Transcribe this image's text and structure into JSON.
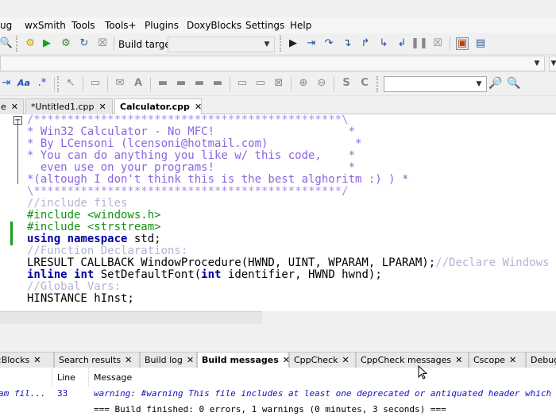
{
  "menu": [
    "ug",
    "wxSmith",
    "Tools",
    "Tools+",
    "Plugins",
    "DoxyBlocks",
    "Settings",
    "Help"
  ],
  "toolbar": {
    "build_target_label": "Build target:",
    "build_target_value": ""
  },
  "tabs": [
    {
      "label": "e",
      "active": false
    },
    {
      "label": "*Untitled1.cpp",
      "active": false
    },
    {
      "label": "Calculator.cpp",
      "active": true
    }
  ],
  "code_lines": [
    {
      "cls": "c-doc-border",
      "text": "/**********************************************\\"
    },
    {
      "cls": "c-doc",
      "text": "* Win32 Calculator - No MFC!                    *"
    },
    {
      "cls": "c-doc",
      "text": "* By LCensoni (lcensoni@hotmail.com)             *"
    },
    {
      "cls": "c-doc",
      "text": "* You can do anything you like w/ this code,    *"
    },
    {
      "cls": "c-doc",
      "text": "  even use on your programs!                    *"
    },
    {
      "cls": "c-doc",
      "text": "*(altough I don't think this is the best alghoritm :) ) *"
    },
    {
      "cls": "c-doc-border",
      "text": "\\**********************************************/"
    },
    {
      "cls": "c-cmt",
      "text": "//include files"
    },
    {
      "cls": "c-pp",
      "text": "#include <windows.h>"
    },
    {
      "cls": "c-pp",
      "text": "#include <strstream>"
    },
    {
      "cls": "mixed-using",
      "text": "using namespace std;"
    },
    {
      "cls": "c-cmt",
      "text": "//Function Declarations:"
    },
    {
      "cls": "mixed-lresult",
      "text": "LRESULT CALLBACK WindowProcedure(HWND, UINT, WPARAM, LPARAM);//Declare Windows procedure"
    },
    {
      "cls": "mixed-inline",
      "text": "inline int SetDefaultFont(int identifier, HWND hwnd);"
    },
    {
      "cls": "c-cmt",
      "text": "//Global Vars:"
    },
    {
      "cls": "c-txt",
      "text": "HINSTANCE hInst;"
    }
  ],
  "code_parts": {
    "using_kw": "using namespace",
    "using_rest": " std;",
    "lresult_code": "LRESULT CALLBACK WindowProcedure(HWND, UINT, WPARAM, LPARAM);",
    "lresult_cmt": "//Declare Windows procedure",
    "inline_kw1": "inline",
    "inline_kw2": "int",
    "inline_mid": " SetDefaultFont(",
    "inline_kw3": "int",
    "inline_rest": " identifier, HWND hwnd);"
  },
  "log_tabs": [
    {
      "label": ":Blocks",
      "active": false
    },
    {
      "label": "Search results",
      "active": false
    },
    {
      "label": "Build log",
      "active": false
    },
    {
      "label": "Build messages",
      "active": true
    },
    {
      "label": "CppCheck",
      "active": false
    },
    {
      "label": "CppCheck messages",
      "active": false
    },
    {
      "label": "Cscope",
      "active": false
    },
    {
      "label": "Debugger",
      "active": false
    }
  ],
  "messages": {
    "col_line": "Line",
    "col_message": "Message",
    "rows": [
      {
        "file": "am fil...",
        "line": "33",
        "message": "warning: #warning This file includes at least one deprecated or antiquated header which",
        "kind": "warn"
      },
      {
        "file": "",
        "line": "",
        "message": "=== Build finished: 0 errors, 1 warnings (0 minutes, 3 seconds) ===",
        "kind": "info"
      }
    ]
  },
  "colors": {
    "doc_comment": "#8a64e0",
    "line_comment": "#b3b3d6",
    "preprocessor": "#139213",
    "keyword": "#0000a0",
    "warning": "#1010c8",
    "change_marker": "#19a019"
  }
}
